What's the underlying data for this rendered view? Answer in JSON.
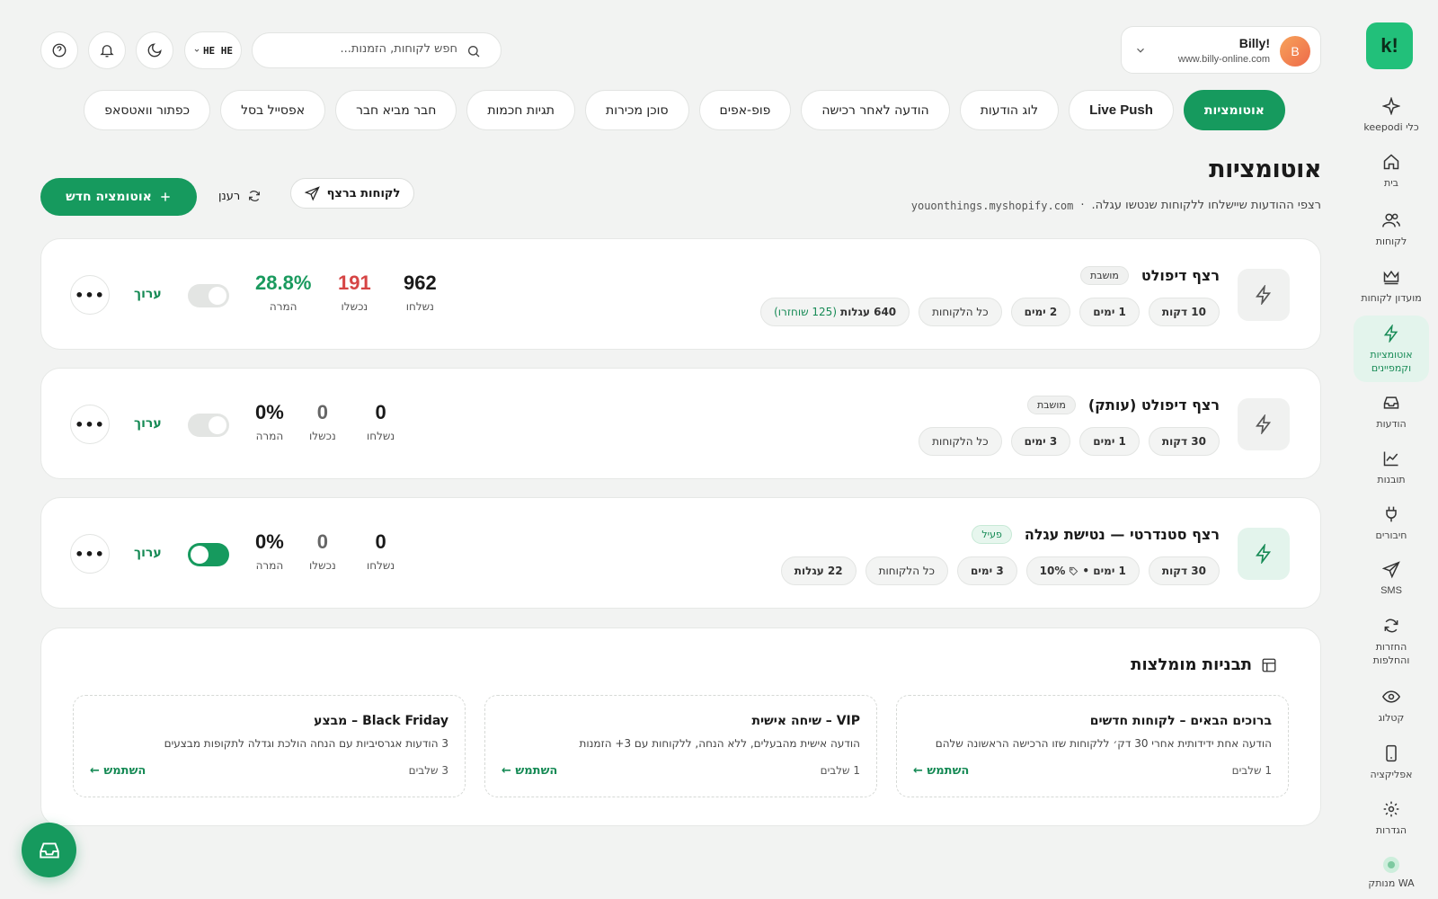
{
  "colors": {
    "accent": "#169a5e",
    "accent_light": "#e3f4ec",
    "danger": "#d64545",
    "background": "#f2f3f2"
  },
  "brand": {
    "logo_text": "!k"
  },
  "sidebar": {
    "items": [
      {
        "label": "כלי keepodi",
        "icon": "sparkle-icon"
      },
      {
        "label": "בית",
        "icon": "home-icon"
      },
      {
        "label": "לקוחות",
        "icon": "users-icon"
      },
      {
        "label": "מועדון לקוחות",
        "icon": "crown-icon"
      },
      {
        "label": "אוטומציות וקמפיינים",
        "icon": "bolt-icon",
        "active": true
      },
      {
        "label": "הודעות",
        "icon": "inbox-icon"
      },
      {
        "label": "תובנות",
        "icon": "chart-icon"
      },
      {
        "label": "חיבורים",
        "icon": "plug-icon"
      },
      {
        "label": "SMS",
        "icon": "send-icon"
      },
      {
        "label": "החזרות והחלפות",
        "icon": "refresh-icon"
      },
      {
        "label": "קטלוג",
        "icon": "eye-icon"
      },
      {
        "label": "אפליקציה",
        "icon": "phone-icon"
      },
      {
        "label": "הגדרות",
        "icon": "gear-icon"
      },
      {
        "label": "WA מנותק",
        "icon": "status-dot-icon"
      }
    ]
  },
  "header": {
    "store_avatar": "B",
    "store_name": "!Billy",
    "store_url": "www.billy-online.com",
    "search_placeholder": "חפש לקוחות, הזמנות...",
    "lang_label": "HE HE"
  },
  "tabs": [
    {
      "label": "אוטומציות",
      "active": true
    },
    {
      "label": "Live Push",
      "en": true
    },
    {
      "label": "לוג הודעות"
    },
    {
      "label": "הודעה לאחר רכישה"
    },
    {
      "label": "פופ-אפים"
    },
    {
      "label": "סוכן מכירות"
    },
    {
      "label": "תגיות חכמות"
    },
    {
      "label": "חבר מביא חבר"
    },
    {
      "label": "אפסייל בסל"
    },
    {
      "label": "כפתור וואטסאפ"
    }
  ],
  "page": {
    "title": "אוטומציות",
    "subtitle": "רצפי ההודעות שיישלחו ללקוחות שנטשו עגלה.",
    "separator": "·",
    "domain": "youonthings.myshopify.com",
    "new_button": "אוטומציה חדש",
    "refresh_label": "רענן",
    "customers_button": "לקוחות ברצף"
  },
  "automations": [
    {
      "name": "רצף דיפולט",
      "status": "מושבת",
      "active": false,
      "chips": [
        "10 דקות",
        "1 ימים",
        "2 ימים",
        "כל הלקוחות"
      ],
      "carts_chip": {
        "count": "640 עגלות",
        "recovered": "(125 שוחזרו)"
      },
      "sent": "962",
      "failed": "191",
      "conversion": "28.8%"
    },
    {
      "name": "רצף דיפולט (עותק)",
      "status": "מושבת",
      "active": false,
      "chips": [
        "30 דקות",
        "1 ימים",
        "3 ימים",
        "כל הלקוחות"
      ],
      "sent": "0",
      "failed": "0",
      "conversion": "0%"
    },
    {
      "name": "רצף סטנדרטי — נטישת עגלה",
      "status": "פעיל",
      "active": true,
      "chips": [
        "30 דקות",
        "1 ימים •",
        "3 ימים",
        "כל הלקוחות",
        "22 עגלות"
      ],
      "discount": "10%",
      "sent": "0",
      "failed": "0",
      "conversion": "0%"
    }
  ],
  "stat_labels": {
    "sent": "נשלחו",
    "failed": "נכשלו",
    "conversion": "המרה"
  },
  "edit_label": "ערוך",
  "more_label": "•••",
  "templates": {
    "title": "תבניות מומלצות",
    "use_label": "השתמש ←",
    "items": [
      {
        "title": "ברוכים הבאים – לקוחות חדשים",
        "desc": "הודעה אחת ידידותית אחרי 30 דק׳ ללקוחות שזו הרכישה הראשונה שלהם",
        "steps": "1 שלבים"
      },
      {
        "title": "VIP – שיחה אישית",
        "desc": "הודעה אישית מהבעלים, ללא הנחה, ללקוחות עם 3+ הזמנות",
        "steps": "1 שלבים"
      },
      {
        "title": "Black Friday – מבצע",
        "desc": "3 הודעות אגרסיביות עם הנחה הולכת וגדלה לתקופות מבצעים",
        "steps": "3 שלבים"
      }
    ]
  }
}
